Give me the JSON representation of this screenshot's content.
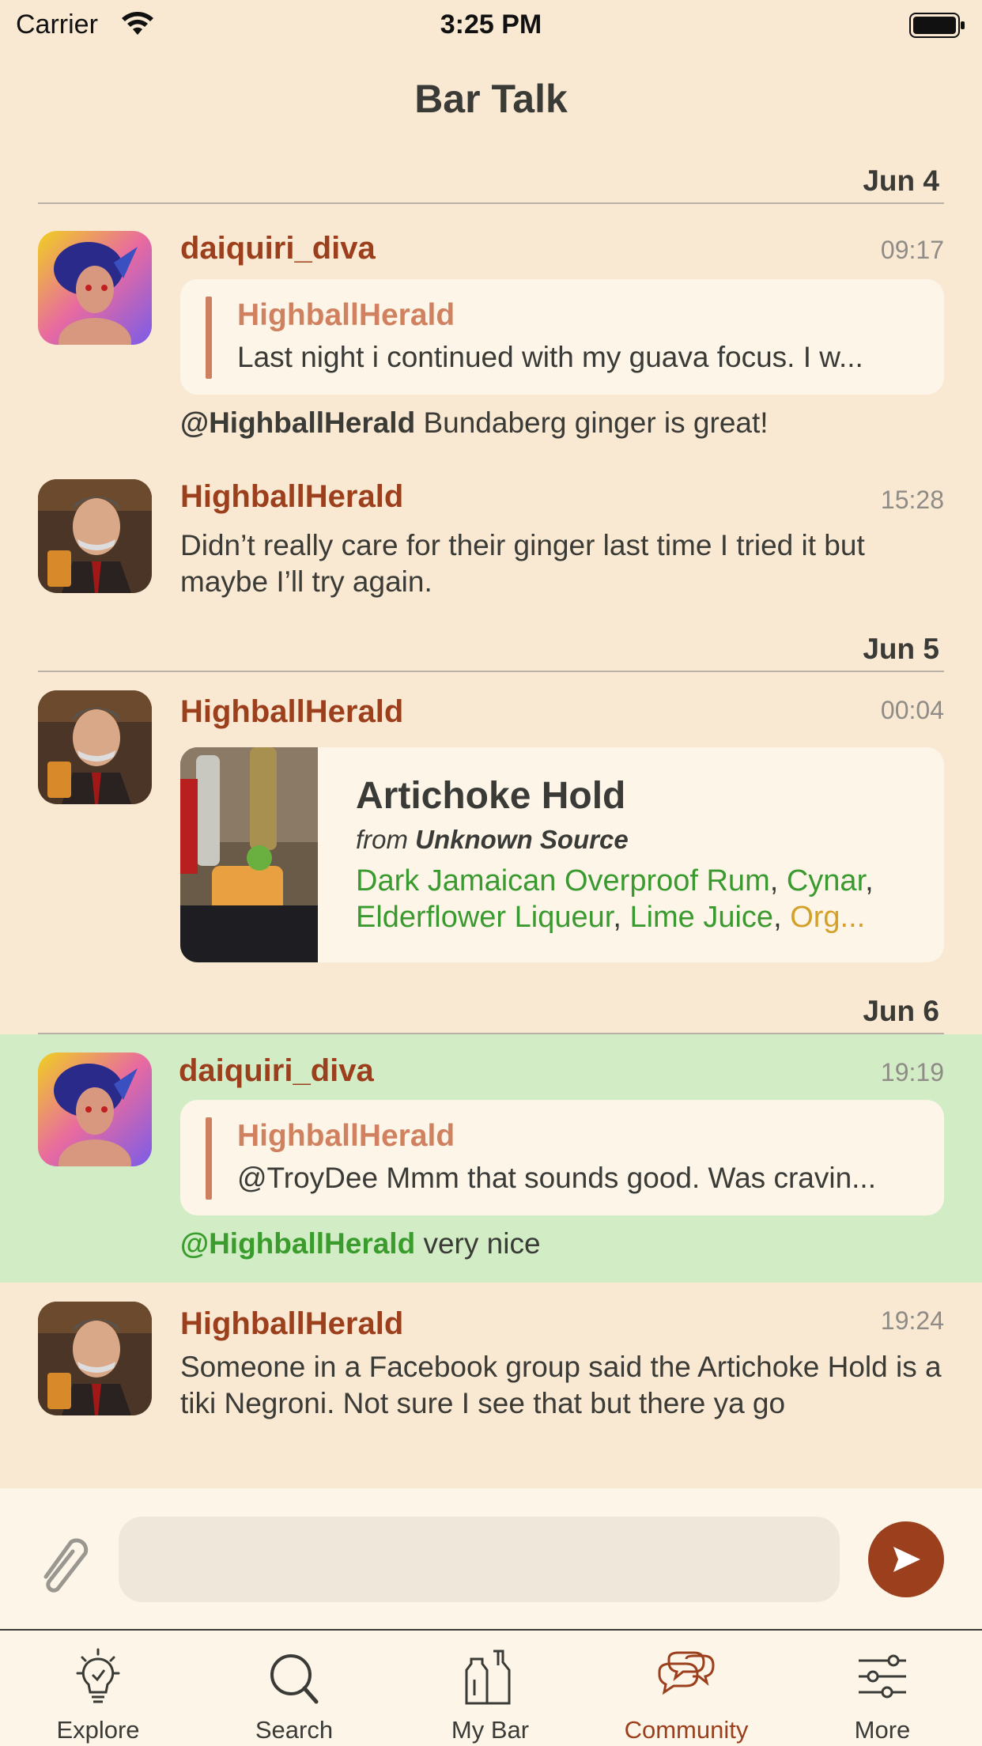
{
  "status_bar": {
    "carrier": "Carrier",
    "time": "3:25 PM"
  },
  "nav": {
    "title": "Bar Talk"
  },
  "date_headers": [
    "Jun 4",
    "Jun 5",
    "Jun 6"
  ],
  "messages": [
    {
      "author": "daiquiri_diva",
      "time": "09:17",
      "quote_author": "HighballHerald",
      "quote_text": "Last night i continued with my guava focus. I w...",
      "mention": "@HighballHerald",
      "text": " Bundaberg ginger is great!"
    },
    {
      "author": "HighballHerald",
      "time": "15:28",
      "text": "Didn’t really care for their ginger last time I tried it but maybe I’ll try again."
    },
    {
      "author": "HighballHerald",
      "time": "00:04",
      "recipe": {
        "title": "Artichoke Hold",
        "from_label": "from ",
        "source": "Unknown Source",
        "ingredients": [
          {
            "name": "Dark Jamaican Overproof Rum",
            "status": "available"
          },
          {
            "name": "Cynar",
            "status": "available"
          },
          {
            "name": "Elderflower Liqueur",
            "status": "available"
          },
          {
            "name": "Lime Juice",
            "status": "available"
          },
          {
            "name": "Org...",
            "status": "substitute"
          }
        ]
      }
    },
    {
      "author": "daiquiri_diva",
      "time": "19:19",
      "quote_author": "HighballHerald",
      "quote_text": "@TroyDee Mmm that sounds good. Was cravin...",
      "mention": "@HighballHerald",
      "text": " very nice",
      "highlighted": true
    },
    {
      "author": "HighballHerald",
      "time": "19:24",
      "text": "Someone in a Facebook group said the Artichoke Hold is a tiki Negroni. Not sure I see that but there ya go"
    }
  ],
  "composer": {
    "placeholder": ""
  },
  "tabs": [
    {
      "label": "Explore",
      "icon": "lightbulb-icon"
    },
    {
      "label": "Search",
      "icon": "search-icon"
    },
    {
      "label": "My Bar",
      "icon": "bottles-icon"
    },
    {
      "label": "Community",
      "icon": "chat-bubbles-icon",
      "active": true
    },
    {
      "label": "More",
      "icon": "sliders-icon"
    }
  ],
  "colors": {
    "background": "#fae9d2",
    "accent": "#9b3f1d",
    "highlight": "#d2edc5",
    "ingredient_available": "#3b9a2f",
    "ingredient_substitute": "#d3a12a"
  }
}
